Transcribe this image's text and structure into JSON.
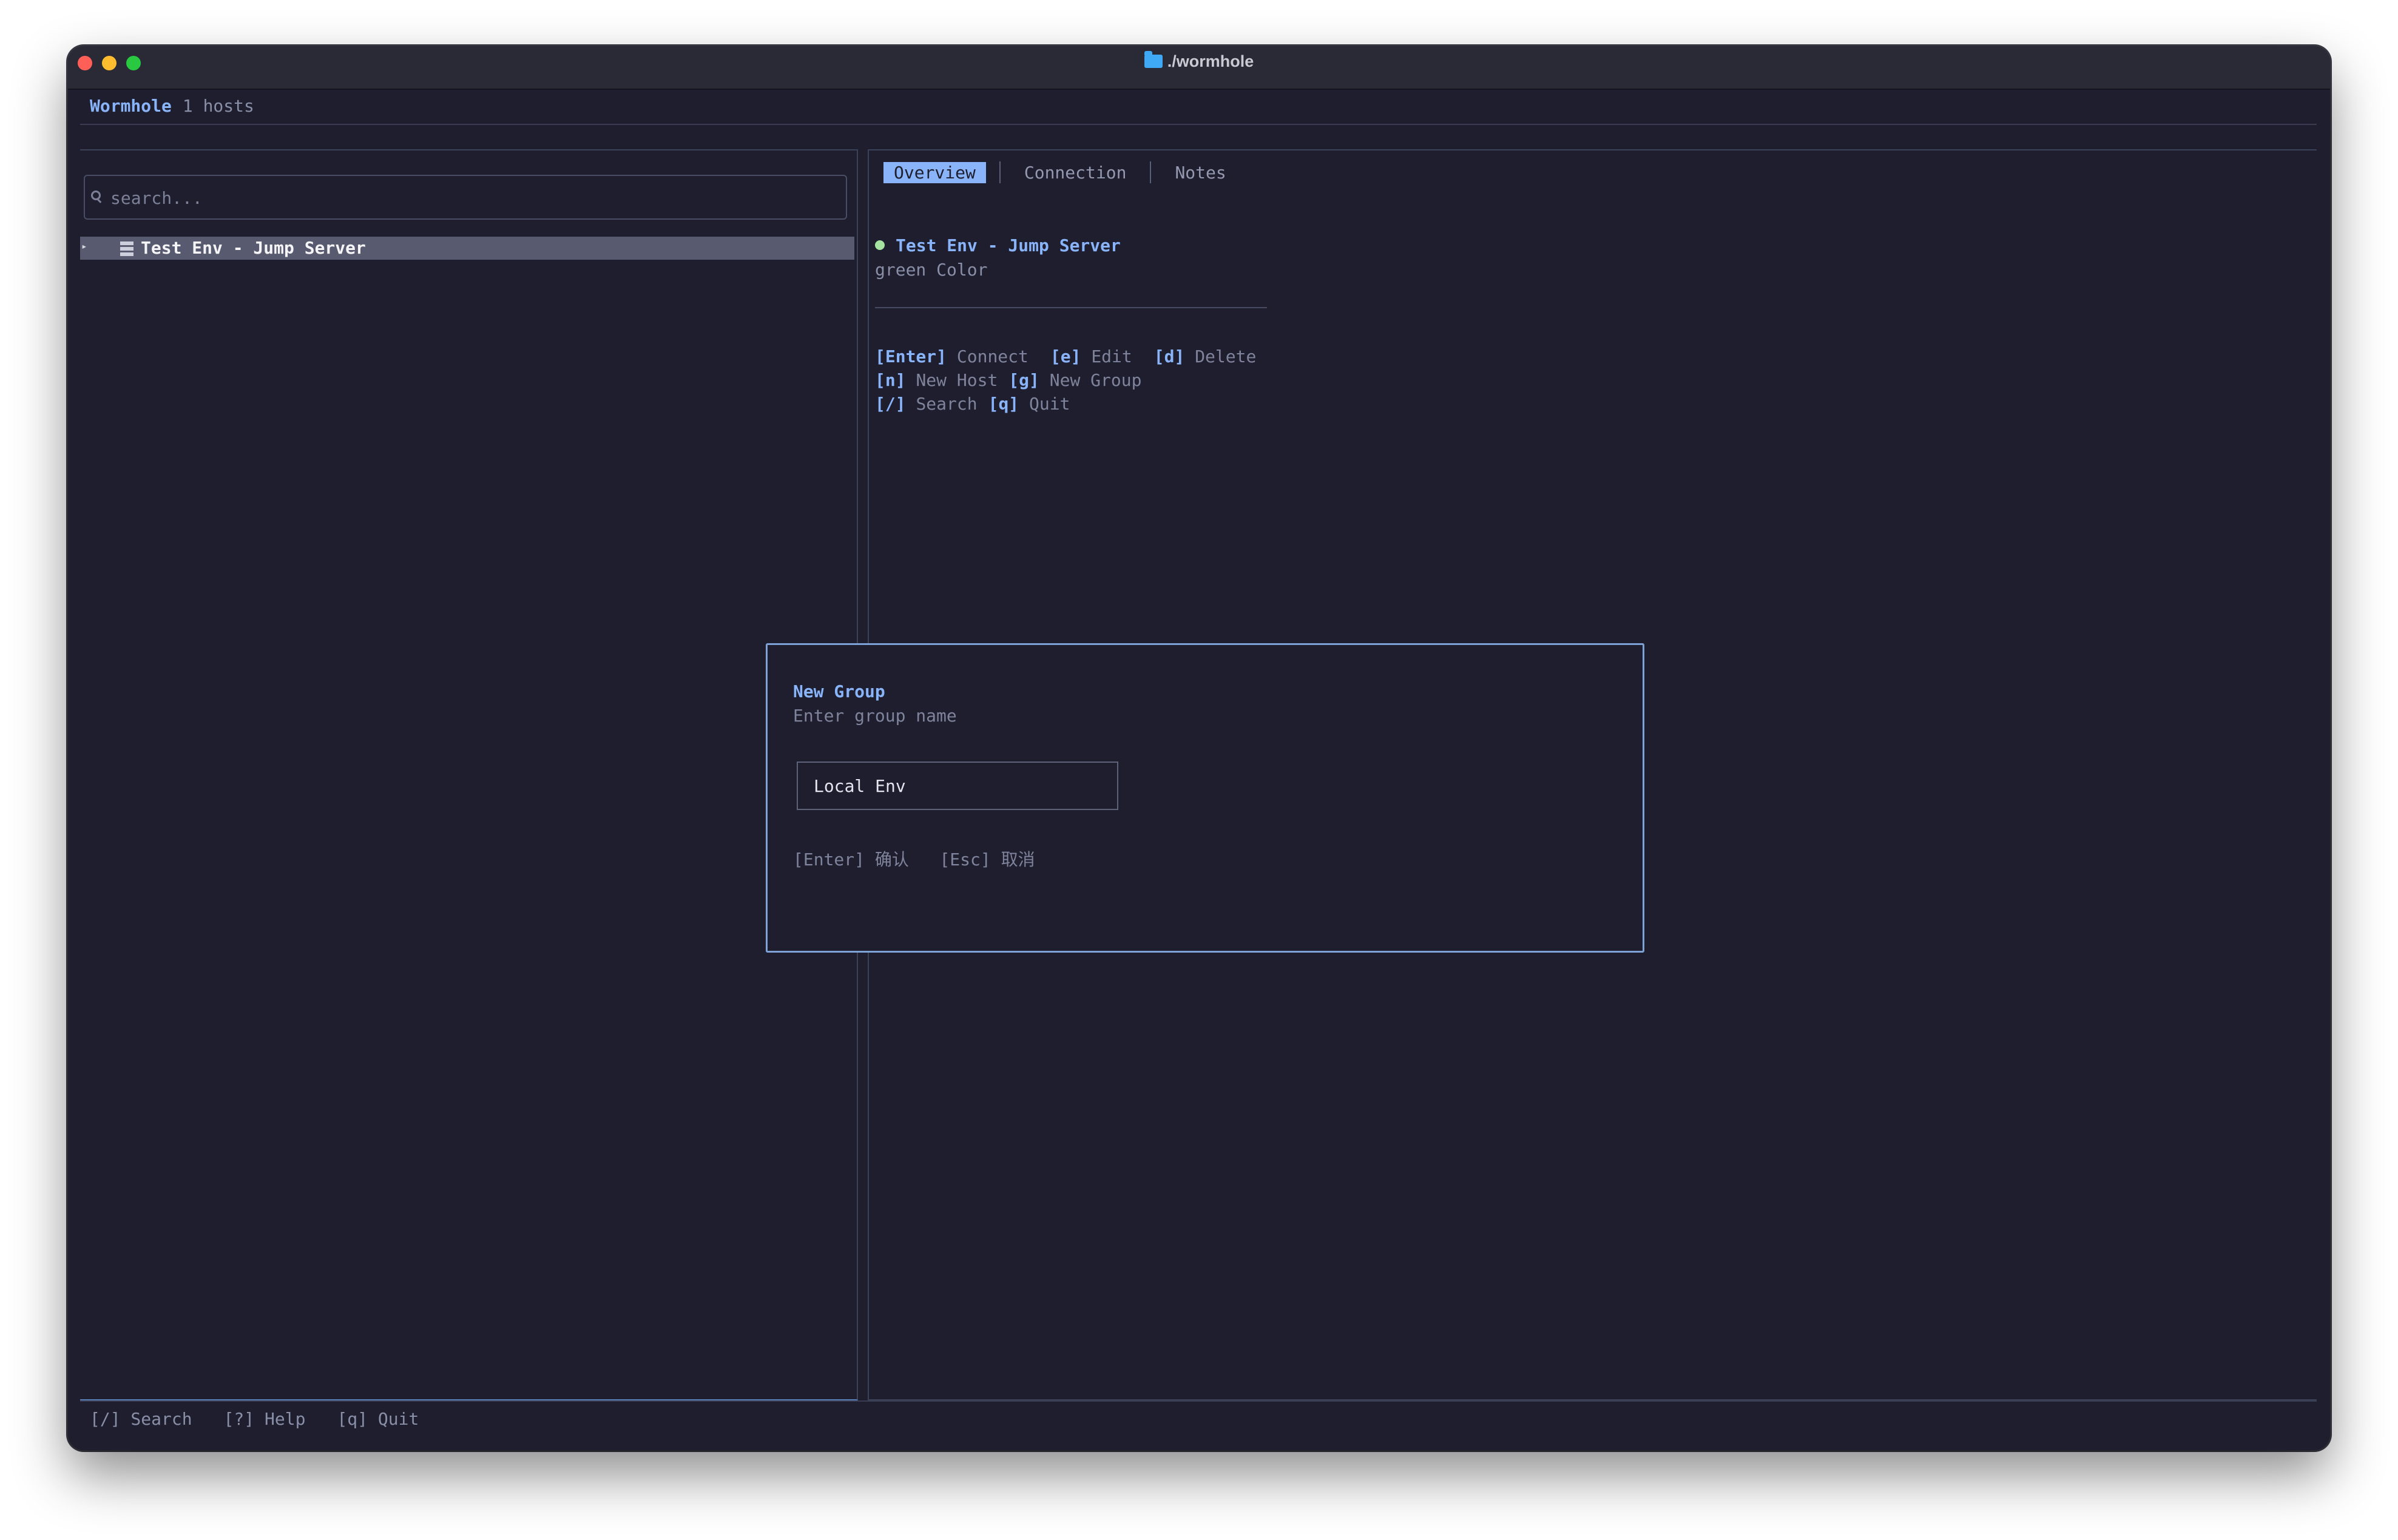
{
  "window": {
    "title": "./wormhole"
  },
  "header": {
    "app_name": "Wormhole",
    "host_count": "1 hosts"
  },
  "search": {
    "placeholder": "search..."
  },
  "tree": {
    "items": [
      {
        "label": "Test Env - Jump Server",
        "selected": true
      }
    ]
  },
  "tabs": [
    {
      "label": "Overview",
      "active": true
    },
    {
      "label": "Connection",
      "active": false
    },
    {
      "label": "Notes",
      "active": false
    }
  ],
  "detail": {
    "title": "Test Env - Jump Server",
    "subtitle": "green Color",
    "status_color": "#a6e3a1",
    "shortcuts": [
      [
        {
          "key": "[Enter]",
          "label": "Connect"
        },
        {
          "key": "[e]",
          "label": "Edit"
        },
        {
          "key": "[d]",
          "label": "Delete"
        }
      ],
      [
        {
          "key": "[n]",
          "label": "New Host"
        },
        {
          "key": "[g]",
          "label": "New Group"
        }
      ],
      [
        {
          "key": "[/]",
          "label": "Search"
        },
        {
          "key": "[q]",
          "label": "Quit"
        }
      ]
    ]
  },
  "modal": {
    "title": "New Group",
    "subtitle": "Enter group name",
    "input_value": "Local Env",
    "hint_confirm": "[Enter] 确认",
    "hint_cancel": "[Esc] 取消"
  },
  "footer": {
    "items": [
      "[/] Search",
      "[?] Help",
      "[q] Quit"
    ]
  },
  "colors": {
    "background": "#1e1e2e",
    "accent": "#89b4fa",
    "muted": "#7f849c",
    "selection": "#585b70"
  }
}
